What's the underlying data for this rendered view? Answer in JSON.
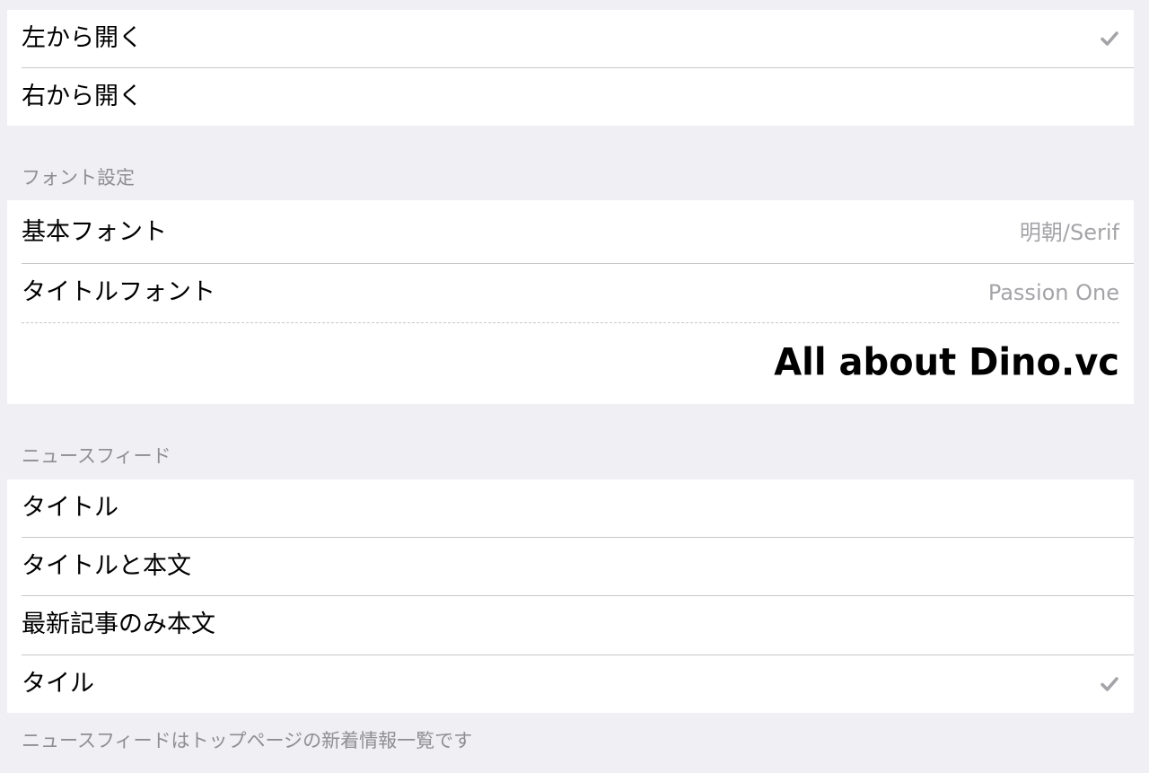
{
  "direction_group": {
    "items": [
      {
        "label": "左から開く",
        "checked": true
      },
      {
        "label": "右から開く",
        "checked": false
      }
    ]
  },
  "font_section": {
    "header": "フォント設定",
    "base_font": {
      "label": "基本フォント",
      "value": "明朝/Serif"
    },
    "title_font": {
      "label": "タイトルフォント",
      "value": "Passion One"
    },
    "preview_text": "All about Dino.vc"
  },
  "news_section": {
    "header": "ニュースフィード",
    "items": [
      {
        "label": "タイトル",
        "checked": false
      },
      {
        "label": "タイトルと本文",
        "checked": false
      },
      {
        "label": "最新記事のみ本文",
        "checked": false
      },
      {
        "label": "タイル",
        "checked": true
      }
    ],
    "footer": "ニュースフィードはトップページの新着情報一覧です"
  },
  "colors": {
    "background": "#efeff4",
    "check": "#a4a4a8"
  }
}
